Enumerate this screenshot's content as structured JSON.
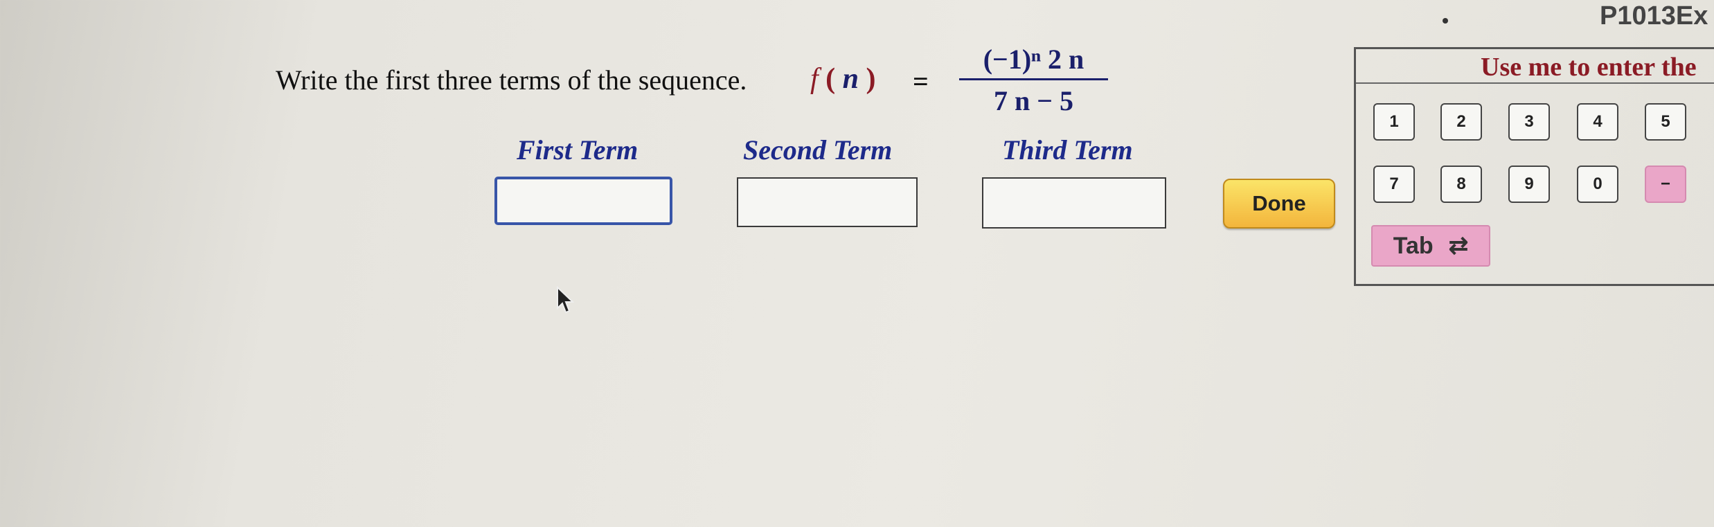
{
  "header": {
    "code": "P1013Ex"
  },
  "question": {
    "prompt": "Write the first three terms of the sequence.",
    "function_name": "f",
    "function_var": "n",
    "equals": "=",
    "numerator": "(−1)ⁿ 2 n",
    "denominator": "7 n − 5"
  },
  "answers": {
    "first_label": "First Term",
    "second_label": "Second Term",
    "third_label": "Third Term",
    "first_value": "",
    "second_value": "",
    "third_value": ""
  },
  "done_label": "Done",
  "keypad": {
    "title": "Use me to enter the",
    "row1": [
      "1",
      "2",
      "3",
      "4",
      "5"
    ],
    "row2": [
      "7",
      "8",
      "9",
      "0",
      "−"
    ],
    "tab_label": "Tab",
    "tab_icon": "⇄"
  },
  "colors": {
    "term_label": "#1d2a8a",
    "title_red": "#8b1b25",
    "done_yellow": "#f3c84a",
    "key_pink": "#eaa6c8"
  }
}
